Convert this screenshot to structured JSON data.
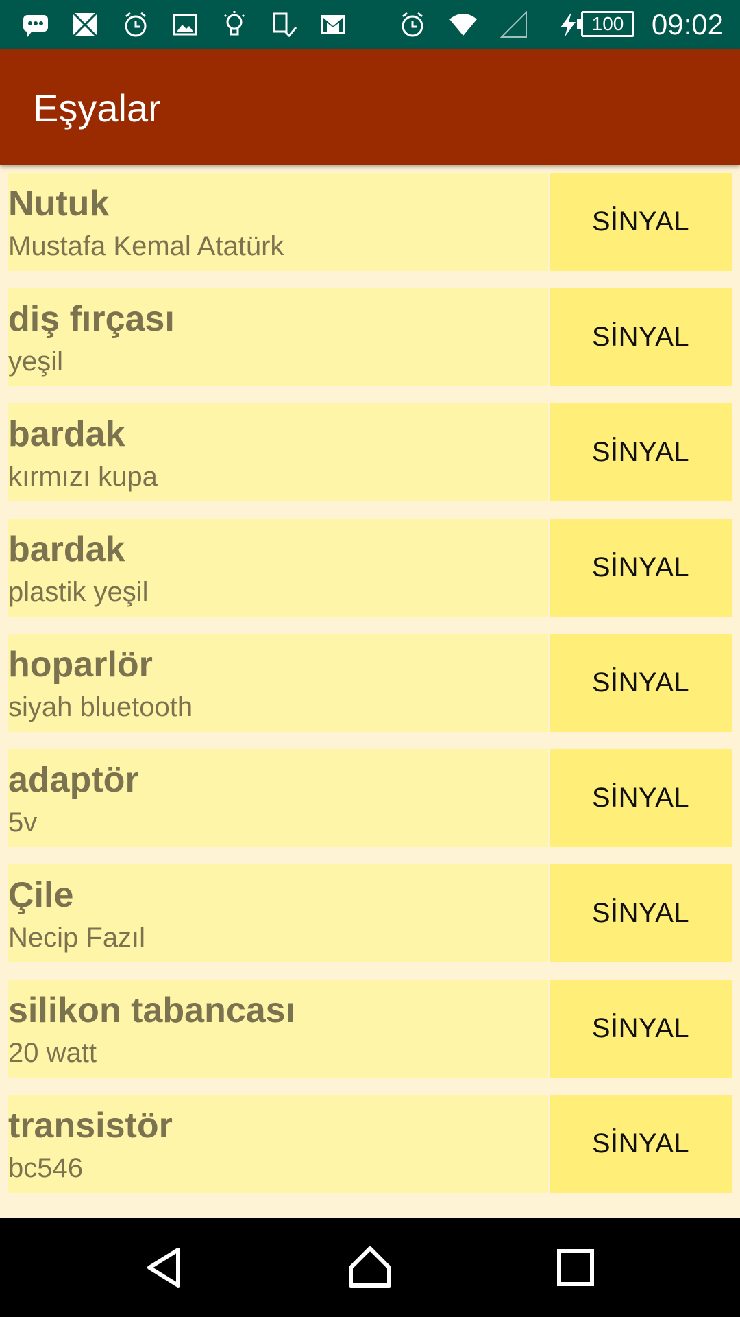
{
  "status_bar": {
    "time": "09:02",
    "battery_level": "100",
    "left_icons": [
      "chat-bubble-icon",
      "app-icon",
      "alarm-icon",
      "image-icon",
      "lightbulb-icon",
      "sim-icon",
      "gmail-icon"
    ],
    "right_icons": [
      "alarm-icon",
      "wifi-icon",
      "signal-icon",
      "charging-icon"
    ]
  },
  "app_bar": {
    "title": "Eşyalar",
    "color": "#9A2A00"
  },
  "items": [
    {
      "name": "Nutuk",
      "desc": "Mustafa Kemal Atatürk",
      "button": "SİNYAL"
    },
    {
      "name": "diş fırçası",
      "desc": "yeşil",
      "button": "SİNYAL"
    },
    {
      "name": "bardak",
      "desc": "kırmızı kupa",
      "button": "SİNYAL"
    },
    {
      "name": "bardak",
      "desc": "plastik yeşil",
      "button": "SİNYAL"
    },
    {
      "name": "hoparlör",
      "desc": "siyah bluetooth",
      "button": "SİNYAL"
    },
    {
      "name": "adaptör",
      "desc": "5v",
      "button": "SİNYAL"
    },
    {
      "name": "Çile",
      "desc": "Necip Fazıl",
      "button": "SİNYAL"
    },
    {
      "name": "silikon tabancası",
      "desc": "20 watt",
      "button": "SİNYAL"
    },
    {
      "name": "transistör",
      "desc": "bc546",
      "button": "SİNYAL"
    }
  ],
  "colors": {
    "status_bar": "#00574B",
    "row_background": "#FFF5A8",
    "button_background": "#FFEE77",
    "text": "#7B7350",
    "page_background": "#FFF3D6"
  },
  "nav_bar": {
    "icons": [
      "back-icon",
      "home-icon",
      "recents-icon"
    ]
  }
}
